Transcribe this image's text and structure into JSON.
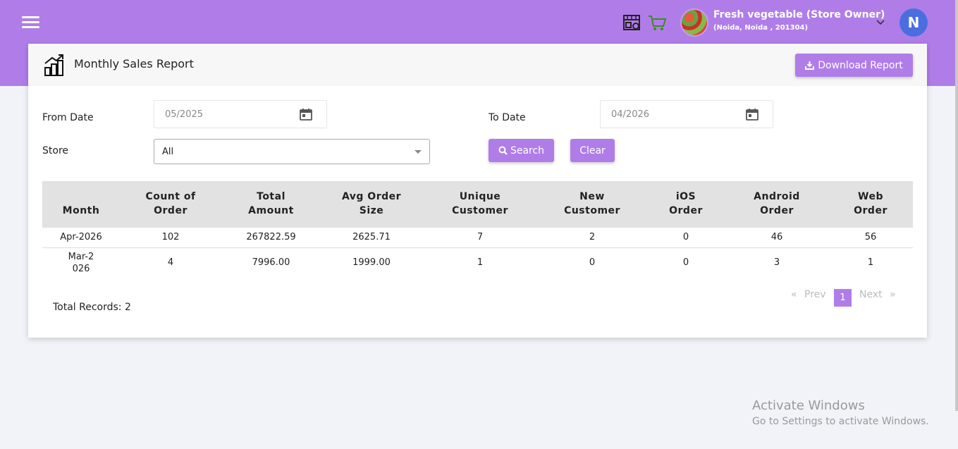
{
  "header": {
    "store_name": "Fresh vegetable (Store Owner)",
    "store_address": "(Noida, Noida , 201304)",
    "user_initial": "N",
    "accent_color": "#b07de8"
  },
  "report": {
    "title": "Monthly Sales Report",
    "download_label": "Download Report",
    "filters": {
      "from_label": "From Date",
      "from_value": "05/2025",
      "to_label": "To Date",
      "to_value": "04/2026",
      "store_label": "Store",
      "store_value": "All",
      "search_label": "Search",
      "clear_label": "Clear"
    },
    "columns": [
      "Month",
      "Count of Order",
      "Total Amount",
      "Avg Order Size",
      "Unique Customer",
      "New Customer",
      "iOS Order",
      "Android Order",
      "Web Order"
    ],
    "rows": [
      [
        "Apr-2026",
        "102",
        "267822.59",
        "2625.71",
        "7",
        "2",
        "0",
        "46",
        "56"
      ],
      [
        "Mar-2026",
        "4",
        "7996.00",
        "1999.00",
        "1",
        "0",
        "0",
        "3",
        "1"
      ]
    ],
    "total_records": "Total Records: 2",
    "pagination": {
      "first": "«",
      "prev": "Prev",
      "current": "1",
      "next": "Next",
      "last": "»"
    }
  },
  "watermark": {
    "line1": "Activate Windows",
    "line2": "Go to Settings to activate Windows."
  }
}
